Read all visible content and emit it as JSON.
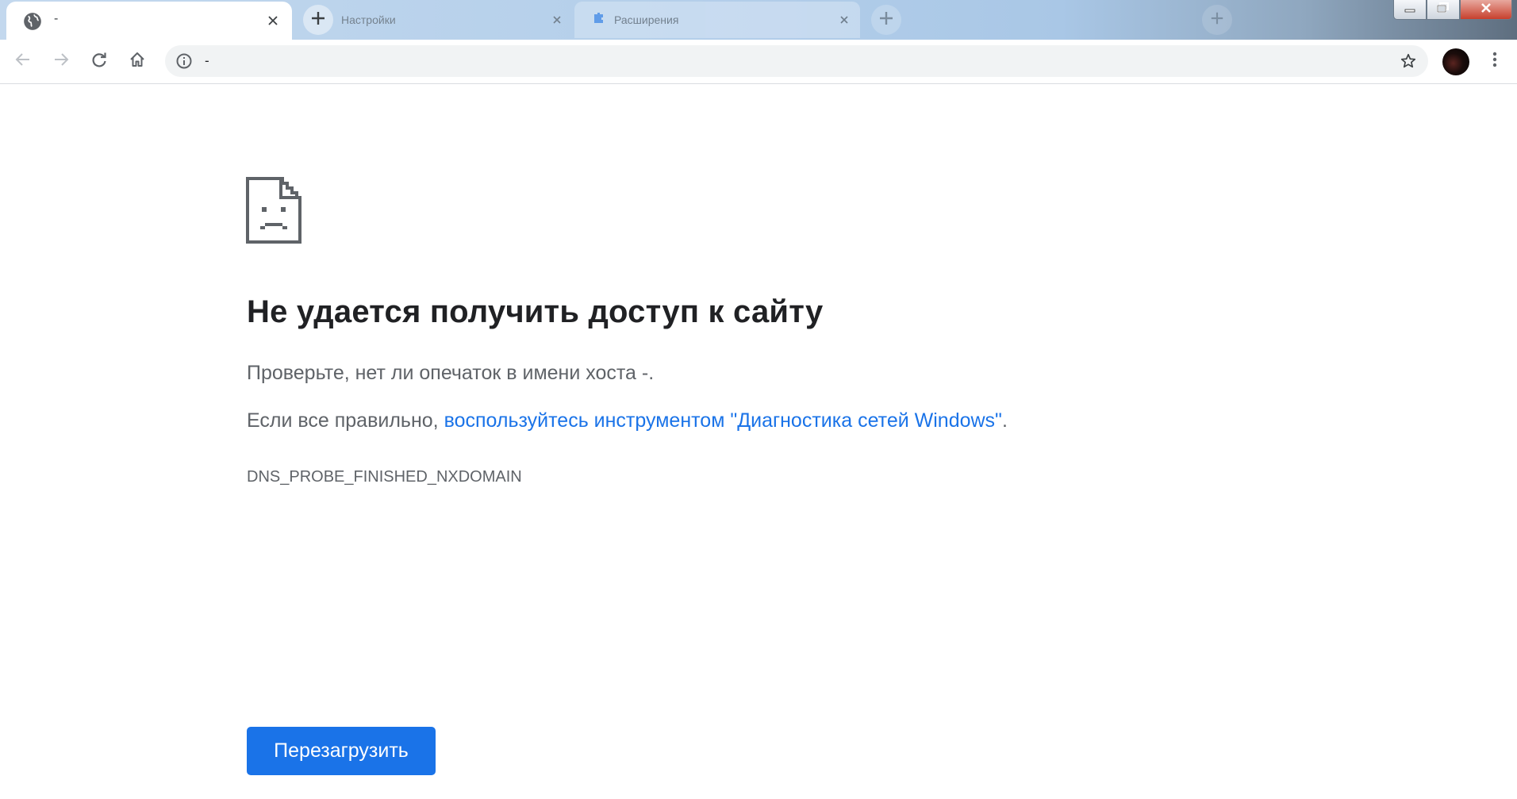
{
  "tabs": [
    {
      "title": "-",
      "active": true
    },
    {
      "title": "Настройки",
      "active": false
    },
    {
      "title": "Расширения",
      "active": false
    }
  ],
  "window_controls": {
    "minimize": "minimize",
    "maximize": "maximize",
    "close": "close"
  },
  "address_bar": {
    "url": "-"
  },
  "error": {
    "title": "Не удается получить доступ к сайту",
    "line1": "Проверьте, нет ли опечаток в имени хоста -.",
    "line2_prefix": "Если все правильно, ",
    "line2_link": "воспользуйтесь инструментом \"Диагностика сетей Windows\"",
    "line2_suffix": ".",
    "code": "DNS_PROBE_FINISHED_NXDOMAIN",
    "reload_label": "Перезагрузить"
  },
  "colors": {
    "accent": "#1a73e8",
    "title_text": "#202124",
    "body_text": "#5f6368",
    "tab_strip": "#b4cfea"
  },
  "icons": {
    "tab_favicon": "globe-icon",
    "tab_close": "close-icon",
    "new_tab": "plus-icon",
    "back": "arrow-left-icon",
    "forward": "arrow-right-icon",
    "reload": "reload-icon",
    "home": "home-icon",
    "site_info": "info-icon",
    "bookmark": "star-icon",
    "menu": "kebab-menu-icon",
    "error": "sad-page-icon"
  }
}
